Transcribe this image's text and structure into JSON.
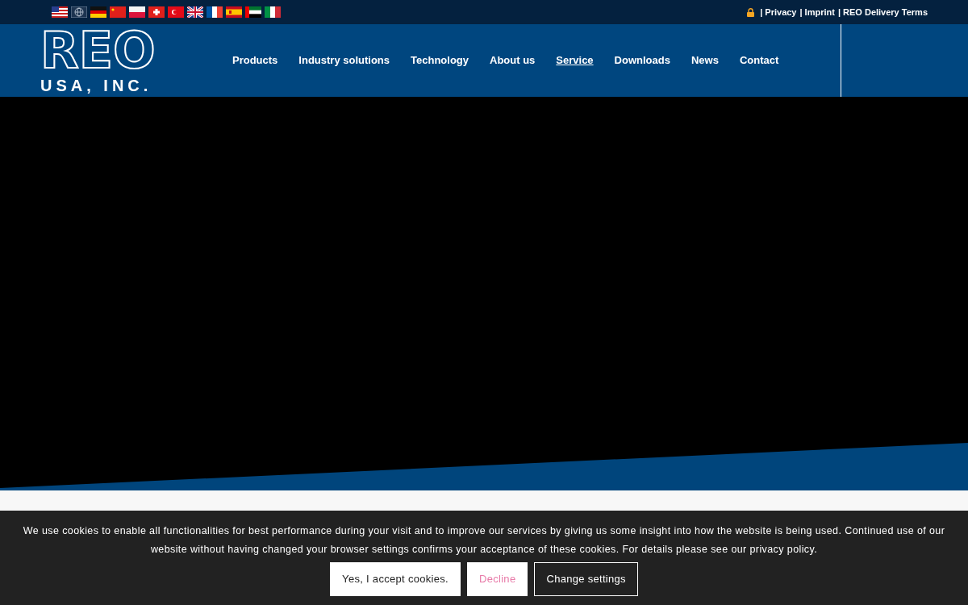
{
  "top_bar": {
    "flags": [
      {
        "kind": "us"
      },
      {
        "kind": "globe"
      },
      {
        "kind": "de"
      },
      {
        "kind": "cn"
      },
      {
        "kind": "pl"
      },
      {
        "kind": "ch"
      },
      {
        "kind": "tr"
      },
      {
        "kind": "gb"
      },
      {
        "kind": "fr"
      },
      {
        "kind": "es"
      },
      {
        "kind": "ae"
      },
      {
        "kind": "it"
      }
    ],
    "links": [
      "| Privacy",
      "| Imprint",
      "| REO Delivery Terms"
    ]
  },
  "logo": {
    "name": "REO",
    "subtitle": "USA, INC."
  },
  "nav": [
    {
      "label": "Products",
      "selected": false
    },
    {
      "label": "Industry solutions",
      "selected": false
    },
    {
      "label": "Technology",
      "selected": false
    },
    {
      "label": "About us",
      "selected": false
    },
    {
      "label": "Service",
      "selected": true
    },
    {
      "label": "Downloads",
      "selected": false
    },
    {
      "label": "News",
      "selected": false
    },
    {
      "label": "Contact",
      "selected": false
    }
  ],
  "cookie_bar": {
    "text": "We use cookies to enable all functionalities for best performance during your visit and to improve our services by giving us some insight into how the website is being used. Continued use of our website without having changed your browser settings confirms your acceptance of these cookies. For details please see our privacy policy.",
    "buttons": [
      {
        "label": "Yes, I accept cookies.",
        "kind": "accept"
      },
      {
        "label": "Decline",
        "kind": "decline"
      },
      {
        "label": "Change settings",
        "kind": "settings"
      }
    ]
  }
}
